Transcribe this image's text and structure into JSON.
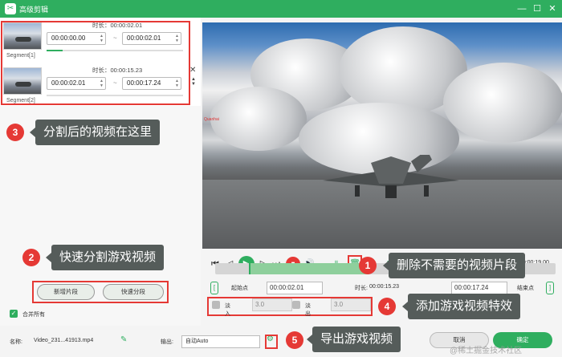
{
  "window": {
    "title": "高级剪辑",
    "minimize": "—",
    "maximize": "☐",
    "close": "✕"
  },
  "segments": [
    {
      "label": "Segment[1]",
      "duration": "时长：00:00:02.01",
      "start": "00:00:00.00",
      "end": "00:00:02.01",
      "progress": 0.12
    },
    {
      "label": "Segment[2]",
      "duration": "时长：00:00:15.23",
      "start": "00:00:02.01",
      "end": "00:00:17.24",
      "progress": 0.0
    }
  ],
  "segment_tilde": "~",
  "callouts": [
    {
      "num": "1",
      "text": "删除不需要的视频片段"
    },
    {
      "num": "2",
      "text": "快速分割游戏视频"
    },
    {
      "num": "3",
      "text": "分割后的视频在这里"
    },
    {
      "num": "4",
      "text": "添加游戏视频特效"
    },
    {
      "num": "5",
      "text": "导出游戏视频"
    }
  ],
  "left_buttons": {
    "new_segment": "新增片段",
    "quick_split": "快速分段"
  },
  "merge_all": "合并所有",
  "player": {
    "timecode": "00:00:15.05/00:00:19.00",
    "video_tag": "Quanhai"
  },
  "trim": {
    "start_label": "起始点",
    "start_value": "00:00:02.01",
    "duration_label": "时长:",
    "duration_value": "00:00:15.23",
    "end_value": "00:00:17.24",
    "end_label": "结束点"
  },
  "fade": {
    "in_label": "淡入",
    "in_value": "3.0",
    "out_label": "淡出",
    "out_value": "3.0"
  },
  "bottom": {
    "name_label": "名称:",
    "file_name": "Video_231...41913.mp4",
    "output_label": "输出:",
    "output_value": "自动Auto",
    "cancel": "取消",
    "ok": "确定"
  },
  "watermark": "@稀土掘金技术社区"
}
